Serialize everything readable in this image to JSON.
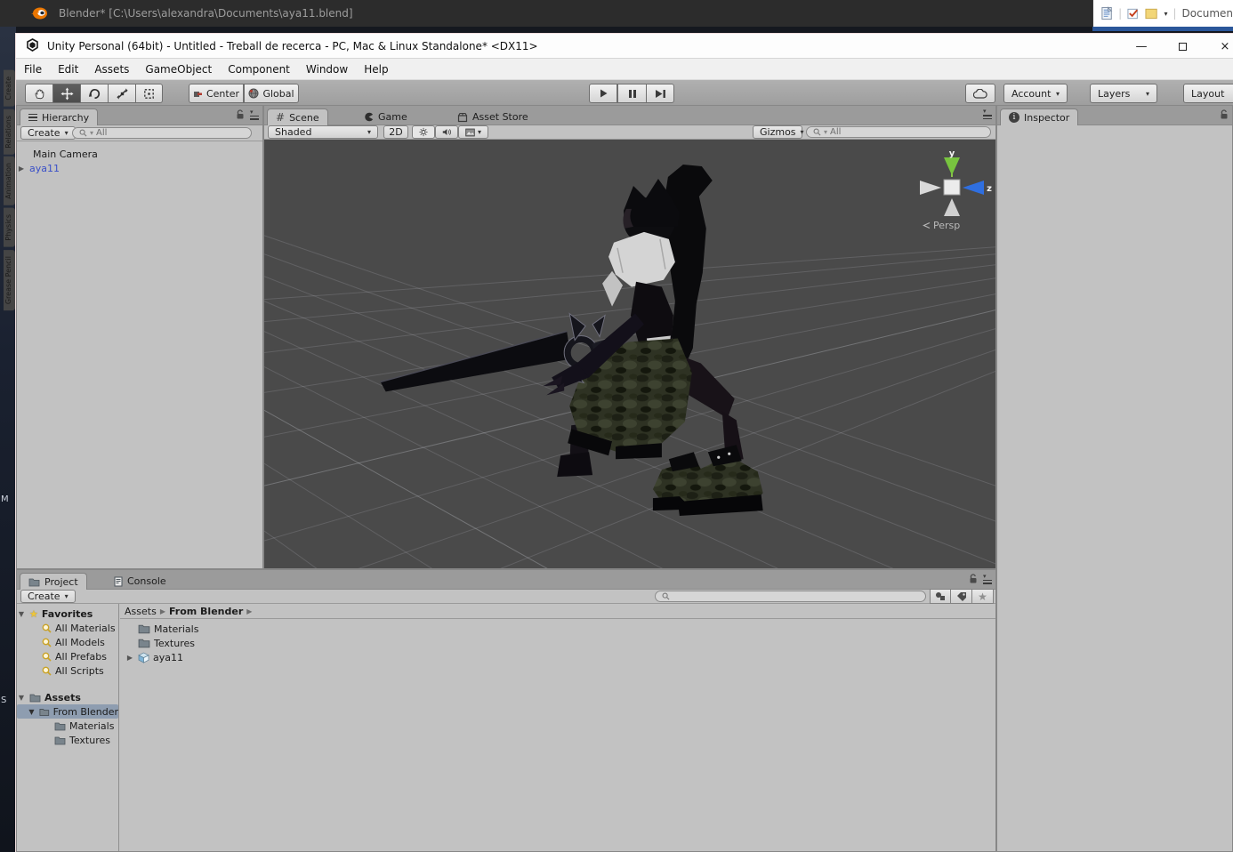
{
  "background": {
    "blender_title": "Blender* [C:\\Users\\alexandra\\Documents\\aya11.blend]",
    "side_tabs": [
      "Create",
      "Relations",
      "Animation",
      "Physics",
      "Grease Pencil"
    ],
    "fragments": [
      "M",
      "S"
    ],
    "office_label": "Documen"
  },
  "unity": {
    "title": "Unity Personal (64bit) - Untitled - Treball de recerca - PC, Mac & Linux Standalone* <DX11>",
    "menus": [
      "File",
      "Edit",
      "Assets",
      "GameObject",
      "Component",
      "Window",
      "Help"
    ],
    "toolbar": {
      "center": "Center",
      "global": "Global",
      "account": "Account",
      "layers": "Layers",
      "layout": "Layout"
    },
    "hierarchy": {
      "tab": "Hierarchy",
      "create": "Create",
      "search_placeholder": "All",
      "items": [
        {
          "label": "Main Camera"
        },
        {
          "label": "aya11"
        }
      ]
    },
    "scene": {
      "tab_scene": "Scene",
      "tab_game": "Game",
      "tab_asset_store": "Asset Store",
      "shaded": "Shaded",
      "mode_2d": "2D",
      "gizmos": "Gizmos",
      "search_placeholder": "All",
      "axis": {
        "y": "y",
        "z": "z",
        "persp": "Persp"
      }
    },
    "inspector": {
      "tab": "Inspector"
    },
    "project": {
      "tab_project": "Project",
      "tab_console": "Console",
      "create": "Create",
      "favorites_label": "Favorites",
      "favorites": [
        "All Materials",
        "All Models",
        "All Prefabs",
        "All Scripts"
      ],
      "assets_label": "Assets",
      "tree_selected": "From Blender",
      "tree_children": [
        "Materials",
        "Textures"
      ],
      "breadcrumb": [
        "Assets",
        "From Blender"
      ],
      "items": [
        "Materials",
        "Textures",
        "aya11"
      ]
    }
  },
  "colors": {
    "panel": "#c2c2c2",
    "viewport": "#4a4a4a",
    "aya11_text": "#3a50c8",
    "favorites_star": "#ecc63d",
    "axis_y_green": "#78c43f",
    "axis_z_blue": "#2f6fe0",
    "word_blue": "#2b579a",
    "blender_orange": "#ea7600",
    "selection": "#8e9db0"
  }
}
